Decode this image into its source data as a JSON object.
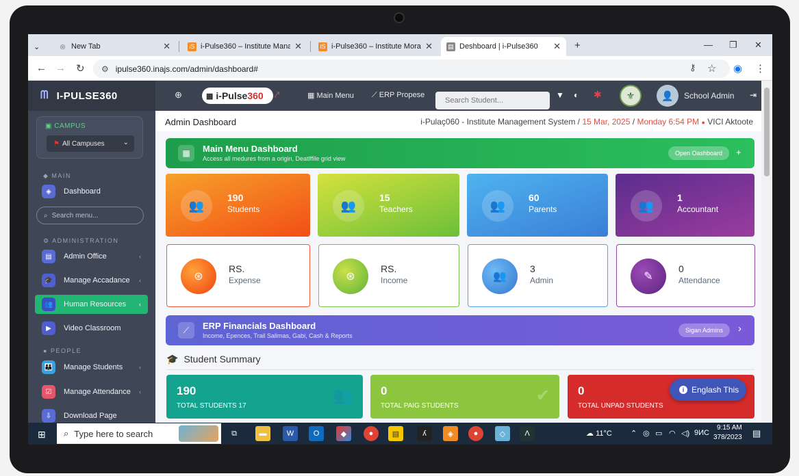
{
  "browser": {
    "tabs": [
      {
        "title": "New Tab",
        "icon": "globe-icon"
      },
      {
        "title": "i-Pulse360 – Institute Managsı",
        "icon": "site-favicon"
      },
      {
        "title": "i-Pulse360 – Institute Moragsı",
        "icon": "site-favicon"
      },
      {
        "title": "Deshboard | i-Pulse360",
        "icon": "site-favicon"
      }
    ],
    "url": "ipulse360.inajs.com/admin/dashboard#"
  },
  "sidebar": {
    "brand": "I-PULSE360",
    "campus_label": "CAMPUS",
    "campus_value": "All Campuses",
    "sections": {
      "main": "MAIN",
      "administration": "ADMINISTRATION",
      "people": "PEOPLE"
    },
    "search_placeholder": "Search menu...",
    "items": [
      {
        "label": "Dashboard",
        "icon": "dashboard-icon"
      },
      {
        "label": "Admin Office",
        "icon": "office-icon"
      },
      {
        "label": "Manage Accadance",
        "icon": "graduation-cap-icon"
      },
      {
        "label": "Human Resources",
        "icon": "people-icon"
      },
      {
        "label": "Video Classroom",
        "icon": "video-icon"
      },
      {
        "label": "Manage Students",
        "icon": "students-icon"
      },
      {
        "label": "Manage Attendance",
        "icon": "attendance-icon"
      },
      {
        "label": "Download Page",
        "icon": "download-icon"
      }
    ]
  },
  "topbar": {
    "logo_text": "i-Pulse",
    "logo_num": "360",
    "main_menu": "Main Menu",
    "erp": "ERP Propese",
    "search_placeholder": "Search Student...",
    "user": "School Admin"
  },
  "page": {
    "title": "Admin Dashboard",
    "breadcrumb_system": "i-Pulaç060 - Institute Management System",
    "breadcrumb_sep": "/",
    "date": "15 Mar, 2025",
    "time": "Monday 6:54 PM",
    "dot": "●",
    "user": "VICI Aktoote"
  },
  "banner_main": {
    "title": "Main Menu Dashboard",
    "subtitle": "Access all medures from a origin, Deatlffile grid view",
    "button": "Open Oashboard",
    "plus": "+"
  },
  "stats": [
    {
      "value": "190",
      "label": "Students"
    },
    {
      "value": "15",
      "label": "Teachers"
    },
    {
      "value": "60",
      "label": "Parents"
    },
    {
      "value": "1",
      "label": "Accountant"
    }
  ],
  "cards": [
    {
      "value": "RS.",
      "label": "Expense"
    },
    {
      "value": "RS.",
      "label": "Income"
    },
    {
      "value": "3",
      "label": "Admin"
    },
    {
      "value": "0",
      "label": "Attendance"
    }
  ],
  "banner_erp": {
    "title": "ERP Financials Dashboard",
    "subtitle": "Income, Epences, Trail Salimas, Gabi, Cash & Reports",
    "button": "Sigan Admins",
    "arrow": "›"
  },
  "summary": {
    "title": "Student Summary",
    "cards": [
      {
        "value": "190",
        "label": "TOTAL STUDENTS 17"
      },
      {
        "value": "0",
        "label": "TOTAL PAIG STUDENTS"
      },
      {
        "value": "0",
        "label": "TOTAL UNPAD STUDENTS"
      }
    ],
    "language_button": "Englash This"
  },
  "taskbar": {
    "search_placeholder": "Type here to search",
    "weather": "11°C",
    "tray_text": "9ИС",
    "time": "9:15 AM",
    "date": "378/2023"
  },
  "colors": {
    "green": "#22b573",
    "orange": "#f25a1c",
    "lime": "#8ec63f",
    "blue": "#3a8fd6",
    "purple": "#8e2f8f",
    "teal": "#13a38e",
    "red": "#d62b2b",
    "erp_banner": "#6a5bd6"
  }
}
